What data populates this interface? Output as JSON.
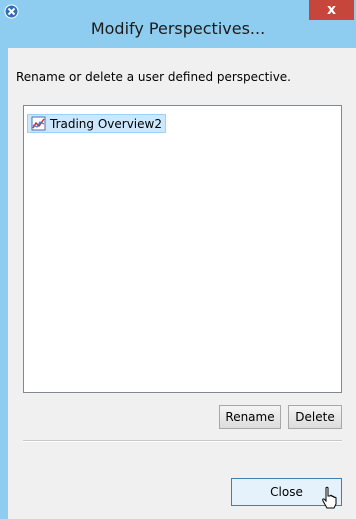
{
  "window": {
    "title": "Modify Perspectives...",
    "close_glyph": "x",
    "app_icon": "perspective-dialog-icon"
  },
  "dialog": {
    "instruction": "Rename or delete a user defined perspective.",
    "perspectives": [
      {
        "label": "Trading Overview2",
        "icon": "perspective-chart-icon",
        "selected": true
      }
    ],
    "rename_label": "Rename",
    "delete_label": "Delete",
    "close_label": "Close"
  },
  "colors": {
    "titlebar": "#8fcdf0",
    "close_button": "#c7463b",
    "selection": "#cce8ff",
    "default_button": "#e5f1fb"
  }
}
